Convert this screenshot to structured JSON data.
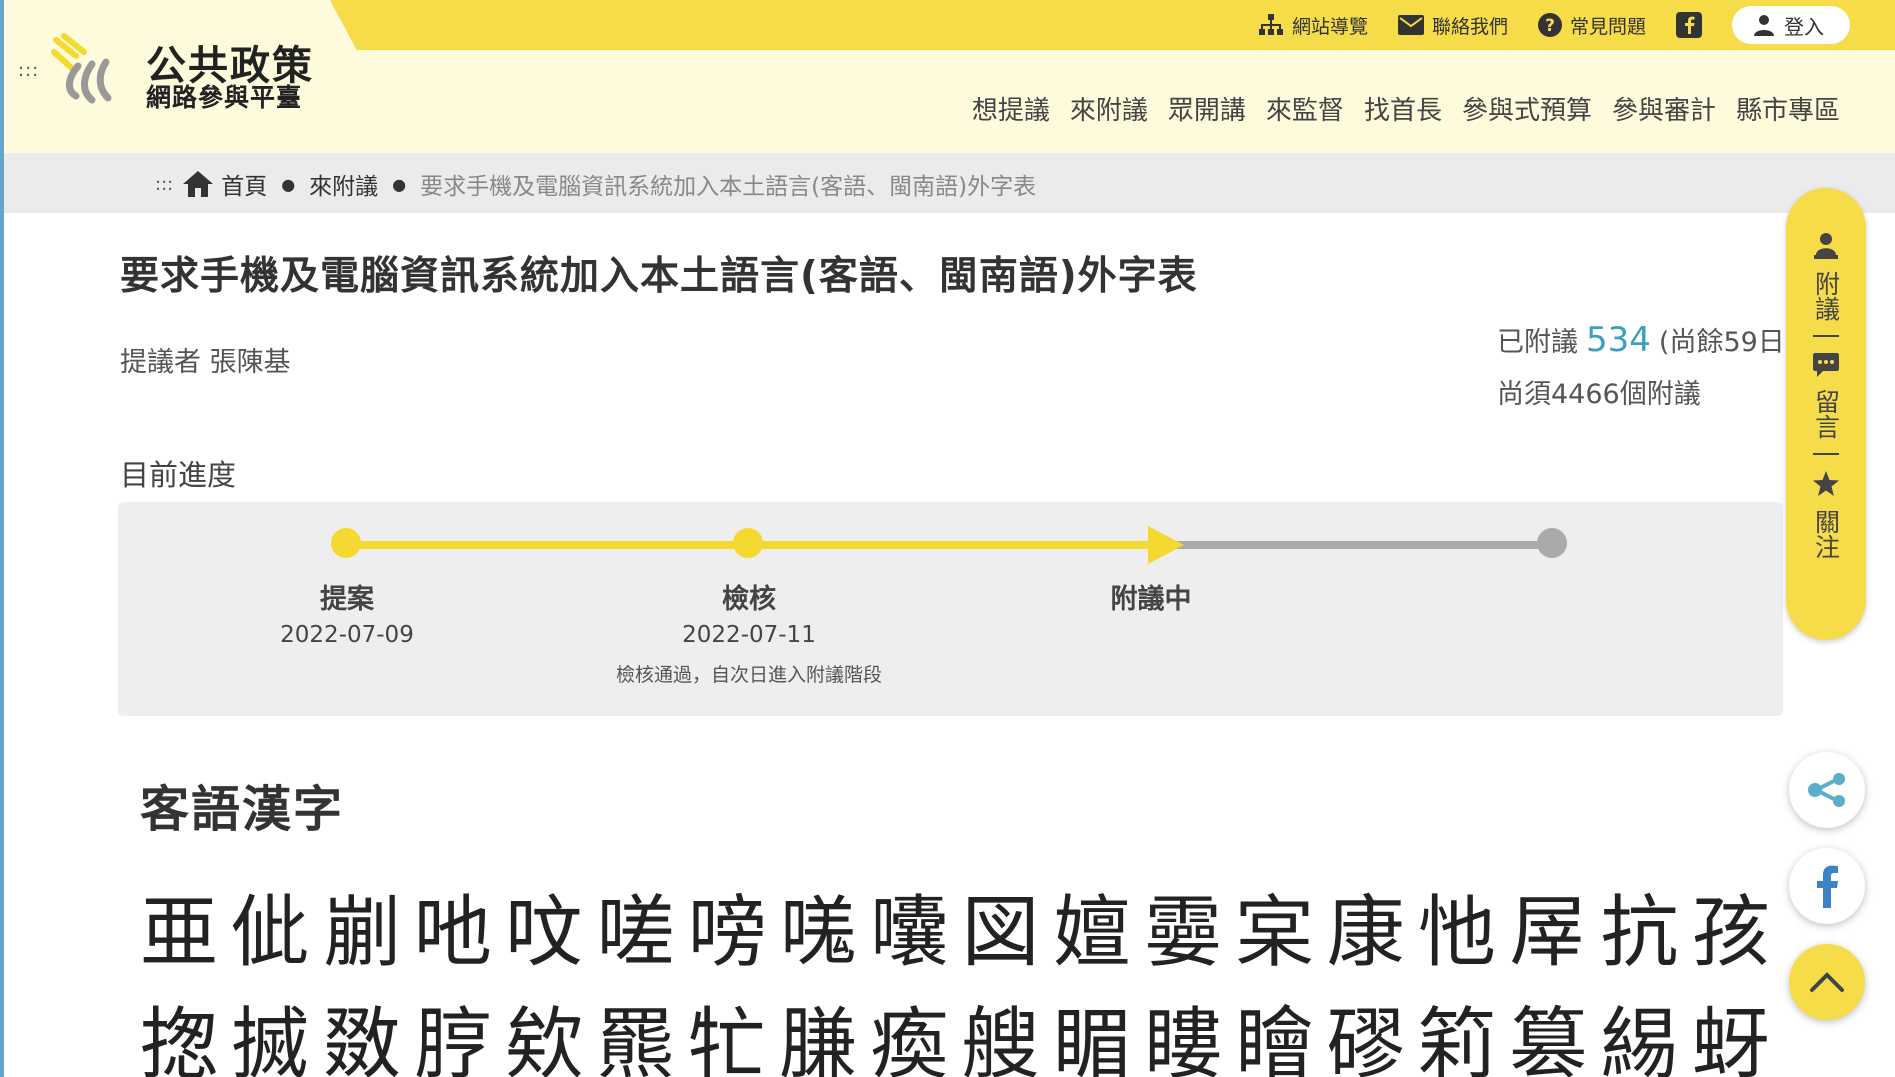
{
  "header": {
    "logo_title": "公共政策",
    "logo_subtitle": "網路參與平臺",
    "menu_dots": ":::",
    "utility": [
      {
        "label": "網站導覽",
        "icon": "sitemap-icon"
      },
      {
        "label": "聯絡我們",
        "icon": "mail-icon"
      },
      {
        "label": "常見問題",
        "icon": "question-icon"
      }
    ],
    "login_label": "登入",
    "nav": [
      "想提議",
      "來附議",
      "眾開講",
      "來監督",
      "找首長",
      "參與式預算",
      "參與審計",
      "縣市專區"
    ]
  },
  "breadcrumb": {
    "dots": ":::",
    "home": "首頁",
    "parent": "來附議",
    "current": "要求手機及電腦資訊系統加入本土語言(客語、閩南語)外字表"
  },
  "proposal": {
    "title": "要求手機及電腦資訊系統加入本土語言(客語、閩南語)外字表",
    "proposer": "提議者 張陳基",
    "seconded_label": "已附議",
    "seconded_count": "534",
    "remaining_days": "(尚餘59日)",
    "needed": "尚須4466個附議"
  },
  "progress": {
    "heading": "目前進度",
    "fraction_complete": 0.67,
    "stages": [
      {
        "name": "提案",
        "date": "2022-07-09",
        "note": ""
      },
      {
        "name": "檢核",
        "date": "2022-07-11",
        "note": "檢核通過，自次日進入附議階段"
      },
      {
        "name": "附議中",
        "date": "",
        "note": ""
      }
    ]
  },
  "content": {
    "section_heading": "客語漢字",
    "row1": [
      "亜",
      "佌",
      "剻",
      "吔",
      "呅",
      "嗟",
      "嗙",
      "嗴",
      "囔",
      "図",
      "嬗",
      "孁",
      "宲",
      "康",
      "忚",
      "屖",
      "抗",
      "孩"
    ],
    "row2": [
      "揔",
      "搣",
      "敪",
      "脝",
      "欸",
      "羆",
      "牤",
      "膁",
      "瘓",
      "艘",
      "睸",
      "瞜",
      "瞺",
      "磟",
      "筣",
      "篡",
      "緆",
      "蚜"
    ]
  },
  "side_panel": {
    "items": [
      {
        "label": "附議",
        "icon": "person-icon"
      },
      {
        "label": "留言",
        "icon": "comment-icon"
      },
      {
        "label": "關注",
        "icon": "star-icon"
      }
    ]
  },
  "colors": {
    "brand_yellow": "#f7dc4a",
    "header_bg": "#fefbdc",
    "count_blue": "#3aa0c0",
    "track_gray": "#aaaaaa"
  }
}
